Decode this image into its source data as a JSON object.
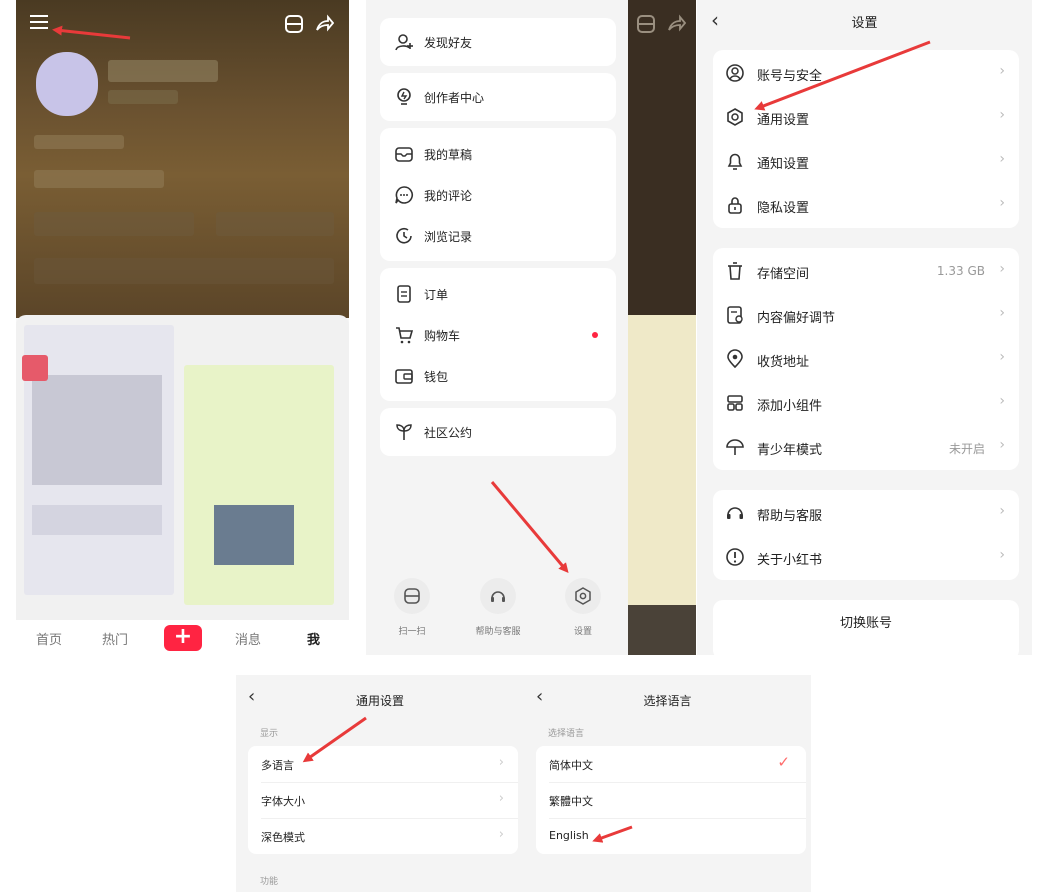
{
  "profile_panel": {
    "nav": [
      "首页",
      "热门",
      "+",
      "消息",
      "我"
    ]
  },
  "drawer_panel": {
    "groups": [
      [
        "发现好友"
      ],
      [
        "创作者中心"
      ],
      [
        "我的草稿",
        "我的评论",
        "浏览记录"
      ],
      [
        "订单",
        "购物车",
        "钱包"
      ],
      [
        "社区公约"
      ]
    ],
    "bottom": [
      "扫一扫",
      "帮助与客服",
      "设置"
    ]
  },
  "settings_panel": {
    "title": "设置",
    "groups": [
      [
        {
          "label": "账号与安全"
        },
        {
          "label": "通用设置"
        },
        {
          "label": "通知设置"
        },
        {
          "label": "隐私设置"
        }
      ],
      [
        {
          "label": "存储空间",
          "value": "1.33 GB"
        },
        {
          "label": "内容偏好调节"
        },
        {
          "label": "收货地址"
        },
        {
          "label": "添加小组件"
        },
        {
          "label": "青少年模式",
          "value": "未开启"
        }
      ],
      [
        {
          "label": "帮助与客服"
        },
        {
          "label": "关于小红书"
        }
      ]
    ],
    "switch_account": "切换账号"
  },
  "general_panel": {
    "title": "通用设置",
    "section_display": "显示",
    "items": [
      "多语言",
      "字体大小",
      "深色模式"
    ],
    "section_function": "功能"
  },
  "language_panel": {
    "title": "选择语言",
    "section": "选择语言",
    "options": [
      "简体中文",
      "繁體中文",
      "English"
    ],
    "selected": "简体中文"
  },
  "colors": {
    "accent_red": "#ff2442",
    "annotation_arrow": "#e83a3a"
  }
}
